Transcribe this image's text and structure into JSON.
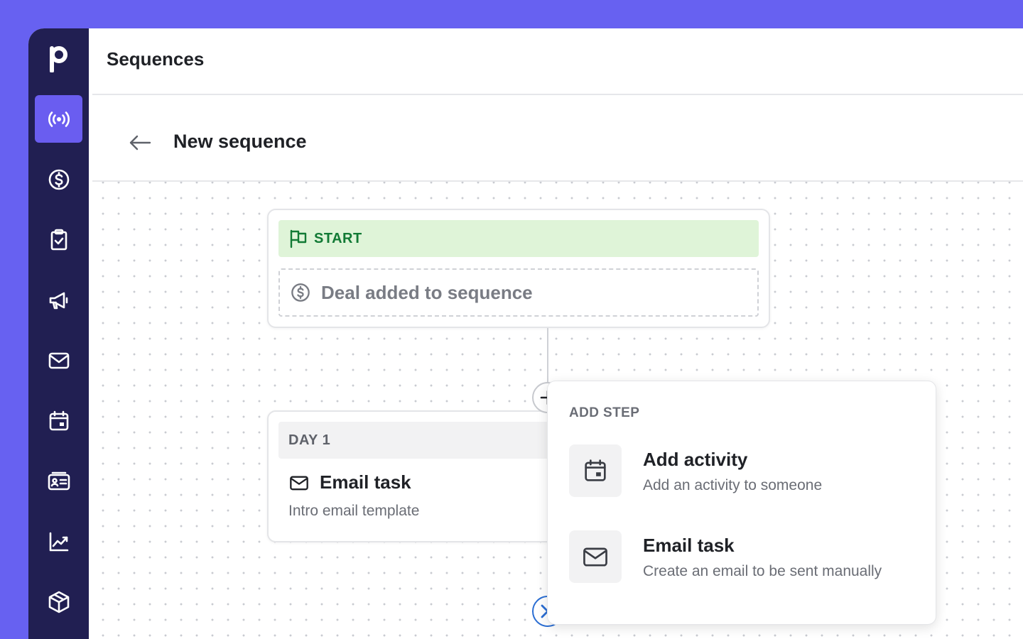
{
  "app": {
    "logo_letter": "p",
    "brand_color": "#6761f1",
    "sidebar_color": "#211f52"
  },
  "sidebar": {
    "items": [
      {
        "icon": "broadcast-icon",
        "active": true
      },
      {
        "icon": "dollar-circle-icon",
        "active": false
      },
      {
        "icon": "clipboard-check-icon",
        "active": false
      },
      {
        "icon": "megaphone-icon",
        "active": false
      },
      {
        "icon": "mail-icon",
        "active": false
      },
      {
        "icon": "calendar-icon",
        "active": false
      },
      {
        "icon": "contact-card-icon",
        "active": false
      },
      {
        "icon": "chart-line-icon",
        "active": false
      },
      {
        "icon": "box-icon",
        "active": false
      }
    ]
  },
  "topbar": {
    "title": "Sequences"
  },
  "header": {
    "back_icon": "arrow-left-icon",
    "title": "New sequence"
  },
  "start": {
    "label": "START",
    "label_icon": "flag-icon",
    "trigger_icon": "dollar-circle-icon",
    "trigger_text": "Deal added to sequence"
  },
  "step": {
    "day_label": "DAY 1",
    "icon": "mail-icon",
    "title": "Email task",
    "subtitle": "Intro email template"
  },
  "add_step": {
    "title": "ADD STEP",
    "options": [
      {
        "icon": "calendar-icon",
        "title": "Add activity",
        "subtitle": "Add an activity to someone"
      },
      {
        "icon": "mail-icon",
        "title": "Email task",
        "subtitle": "Create an email to be sent manually"
      }
    ]
  },
  "colors": {
    "start_bg": "#dff4d8",
    "start_text": "#127a35",
    "close_accent": "#2b6ed3"
  }
}
